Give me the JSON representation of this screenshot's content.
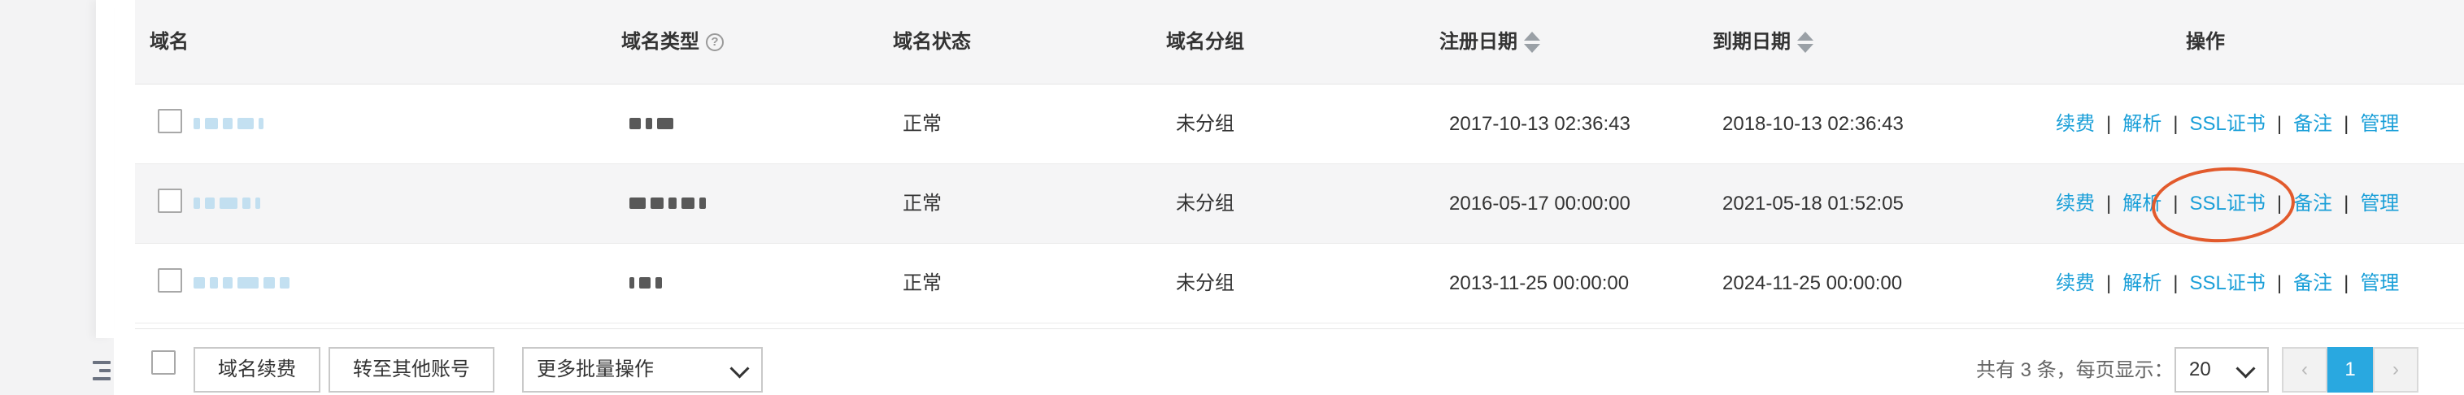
{
  "colors": {
    "link": "#1a9fd8",
    "highlight": "#e25a2c",
    "active_page": "#29a8e0"
  },
  "table": {
    "columns": [
      "域名",
      "域名类型",
      "域名状态",
      "域名分组",
      "注册日期",
      "到期日期",
      "操作"
    ],
    "rows": [
      {
        "status": "正常",
        "group": "未分组",
        "registered": "2017-10-13 02:36:43",
        "expires": "2018-10-13 02:36:43"
      },
      {
        "status": "正常",
        "group": "未分组",
        "registered": "2016-05-17 00:00:00",
        "expires": "2021-05-18 01:52:05"
      },
      {
        "status": "正常",
        "group": "未分组",
        "registered": "2013-11-25 00:00:00",
        "expires": "2024-11-25 00:00:00"
      }
    ],
    "actions": [
      "续费",
      "解析",
      "SSL证书",
      "备注",
      "管理"
    ],
    "separator": "|"
  },
  "footer": {
    "renew_button": "域名续费",
    "transfer_button": "转至其他账号",
    "batch_select": "更多批量操作",
    "summary": "共有 3 条，每页显示：",
    "page_size": "20",
    "prev": "‹",
    "current_page": "1",
    "next": "›"
  }
}
